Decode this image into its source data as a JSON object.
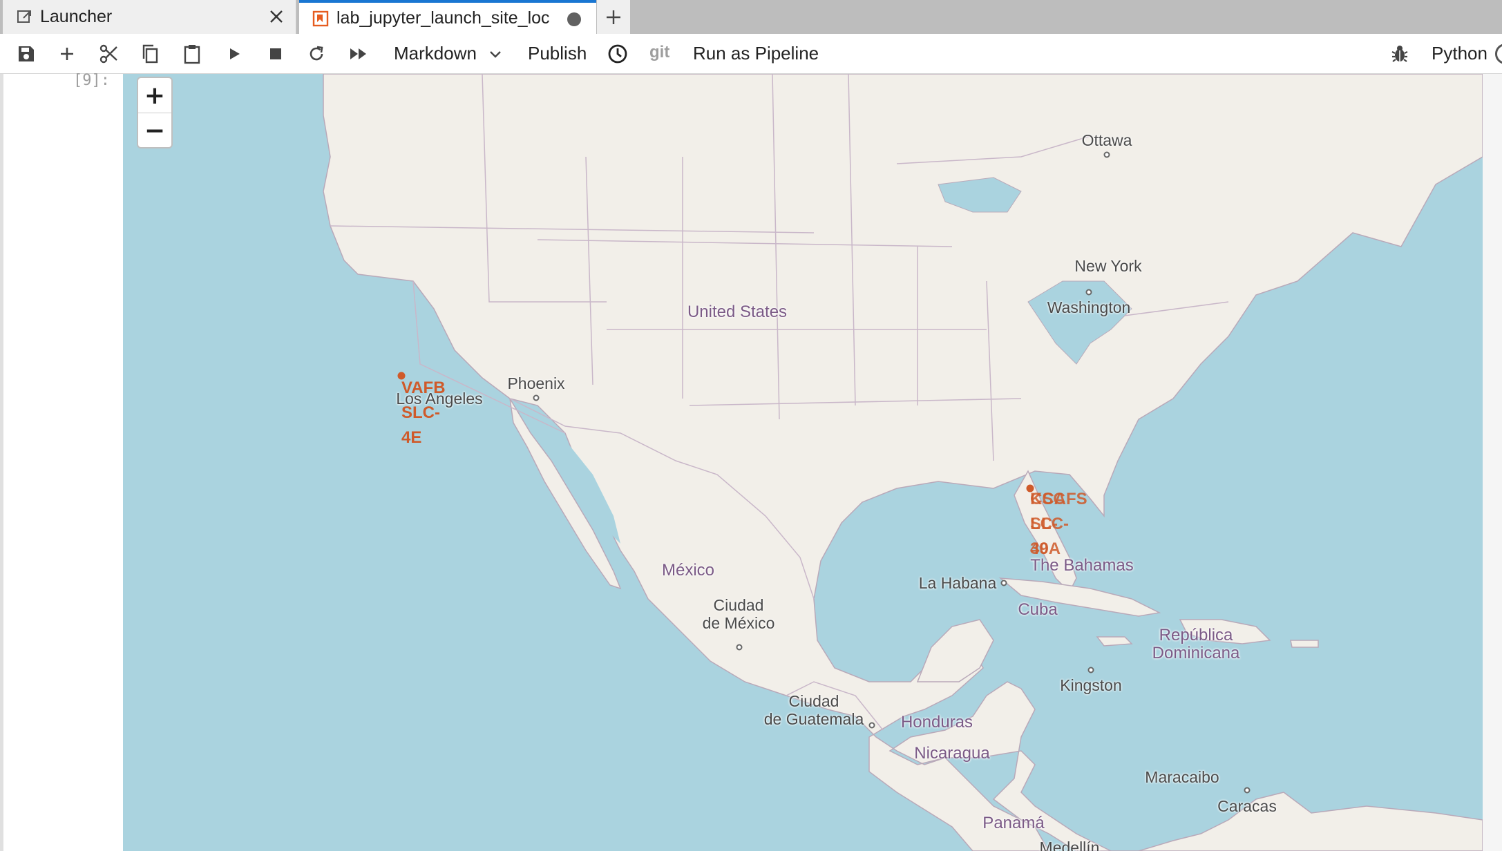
{
  "tabs": {
    "launcher_label": "Launcher",
    "notebook_label": "lab_jupyter_launch_site_loc"
  },
  "toolbar": {
    "cell_type": "Markdown",
    "publish": "Publish",
    "git": "git",
    "run_pipeline": "Run as Pipeline",
    "kernel": "Python"
  },
  "cell": {
    "prompt": "[9]:"
  },
  "map": {
    "zoom_in": "+",
    "zoom_out": "−",
    "labels": {
      "ottawa": "Ottawa",
      "new_york": "New York",
      "washington": "Washington",
      "united_states": "United States",
      "phoenix": "Phoenix",
      "los_angeles": "Los Angeles",
      "mexico": "México",
      "ciudad_mexico_1": "Ciudad",
      "ciudad_mexico_2": "de México",
      "la_habana": "La Habana",
      "cuba": "Cuba",
      "bahamas": "The Bahamas",
      "republica_1": "República",
      "republica_2": "Dominicana",
      "kingston": "Kingston",
      "ciudad_guatemala_1": "Ciudad",
      "ciudad_guatemala_2": "de Guatemala",
      "honduras": "Honduras",
      "nicaragua": "Nicaragua",
      "maracaibo": "Maracaibo",
      "caracas": "Caracas",
      "panama": "Panamá",
      "medellin": "Medellín"
    },
    "sites": {
      "vafb": "VAFB SLC-4E",
      "ccafs_overlap_a": "CCAFS SLC-40",
      "ccafs_overlap_b": "KSC LC-39A"
    },
    "colors": {
      "water": "#aad3df",
      "land": "#f2efe9",
      "site": "#cf5a2a"
    }
  }
}
